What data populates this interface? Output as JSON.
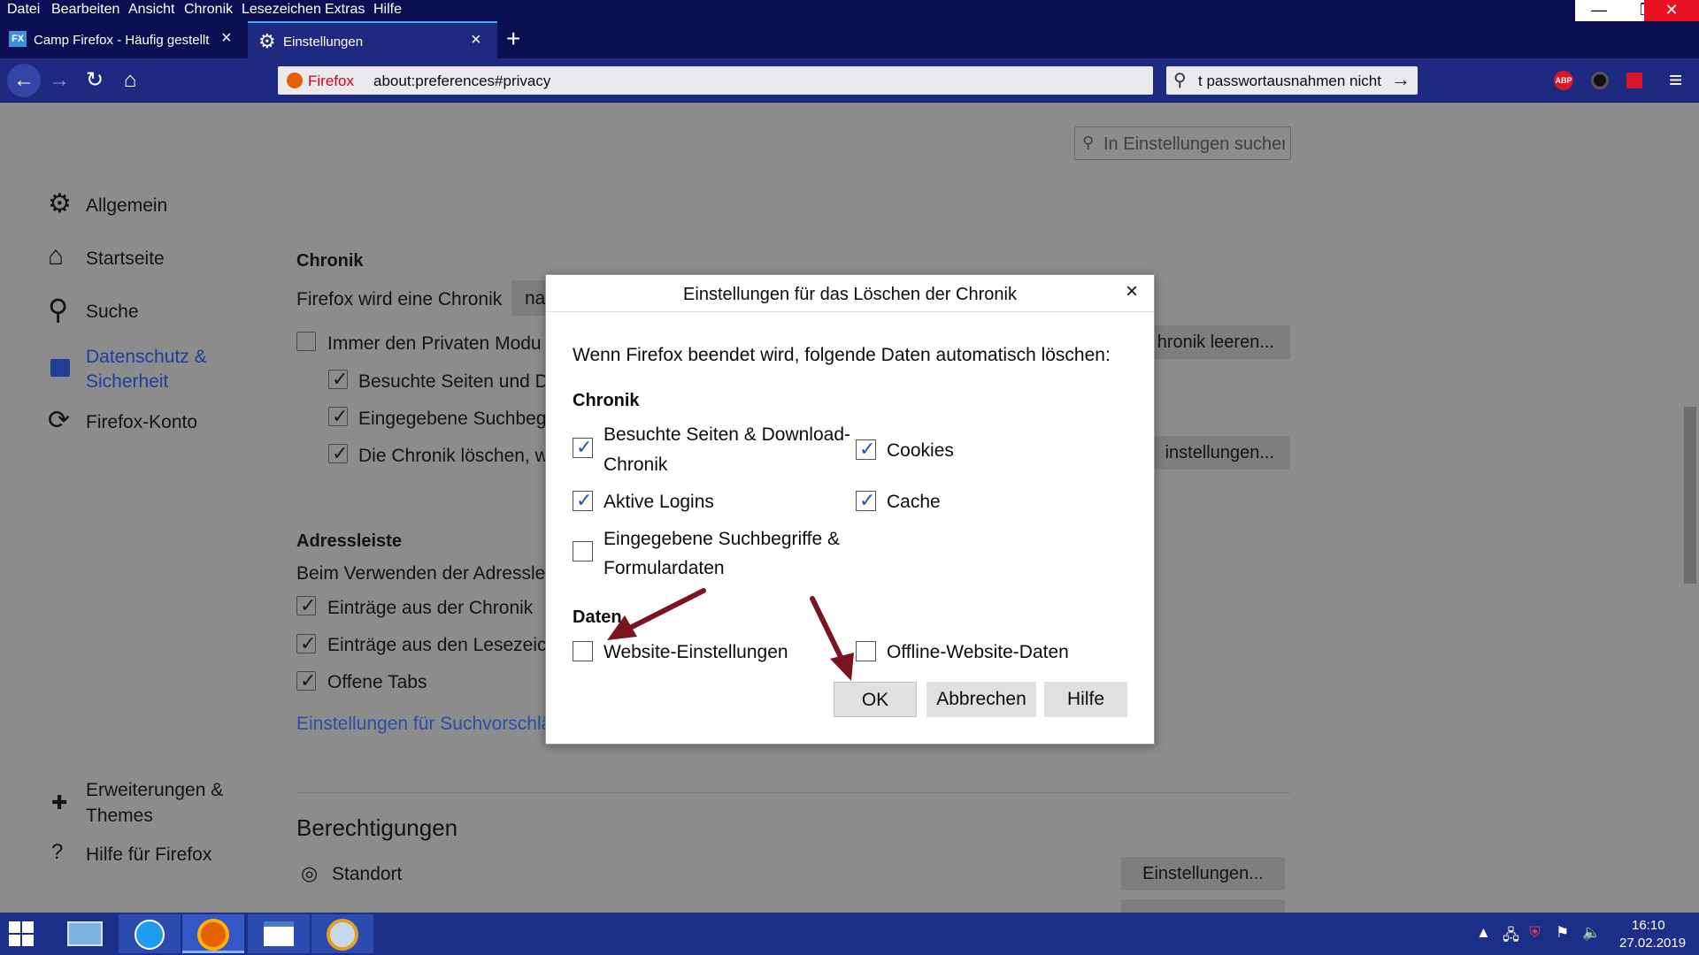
{
  "menu": {
    "items": [
      "Datei",
      "Bearbeiten",
      "Ansicht",
      "Chronik",
      "Lesezeichen",
      "Extras",
      "Hilfe"
    ],
    "window_controls": [
      "—",
      "❐",
      "✕"
    ]
  },
  "tabs": [
    {
      "label": "Camp Firefox - Häufig gestellt",
      "icon": "fx-site-icon"
    },
    {
      "label": "Einstellungen",
      "icon": "gear-icon"
    }
  ],
  "navbar": {
    "url_brand": "Firefox",
    "url": "about:preferences#privacy",
    "search_text": "t passwortausnahmen nicht"
  },
  "content": {
    "settings_search_placeholder": "In Einstellungen suchen",
    "sidebar": [
      {
        "label": "Allgemein",
        "icon": "gear-icon"
      },
      {
        "label": "Startseite",
        "icon": "home-icon"
      },
      {
        "label": "Suche",
        "icon": "search-icon"
      },
      {
        "label": "Datenschutz & Sicherheit",
        "icon": "lock-icon"
      },
      {
        "label": "Firefox-Konto",
        "icon": "sync-icon"
      }
    ],
    "sidebar_bottom": [
      {
        "label": "Erweiterungen & Themes",
        "icon": "puzzle-icon"
      },
      {
        "label": "Hilfe für Firefox",
        "icon": "help-icon"
      }
    ],
    "chronik": {
      "title": "Chronik",
      "line": "Firefox wird eine Chronik",
      "select_value": "na",
      "always_private": "Immer den Privaten Modu",
      "visited": "Besuchte Seiten und D",
      "searches": "Eingegebene Suchbeg",
      "clear_on_close": "Die Chronik löschen, w",
      "clear_button": "hronik leeren...",
      "settings_button": "instellungen..."
    },
    "adressleiste": {
      "title": "Adressleiste",
      "line": "Beim Verwenden der Adressle",
      "items": [
        "Einträge aus der Chronik",
        "Einträge aus den Lesezeich",
        "Offene Tabs"
      ],
      "link": "Einstellungen für Suchvorschlä"
    },
    "berechtigungen": {
      "title": "Berechtigungen",
      "standort": "Standort",
      "standort_button": "Einstellungen..."
    }
  },
  "dialog": {
    "title": "Einstellungen für das Löschen der Chronik",
    "intro": "Wenn Firefox beendet wird, folgende Daten automatisch löschen:",
    "chronik_title": "Chronik",
    "visited_l1": "Besuchte Seiten & Download-",
    "visited_l2": "Chronik",
    "visited_checked": true,
    "logins": "Aktive Logins",
    "logins_checked": true,
    "forms_l1": "Eingegebene Suchbegriffe &",
    "forms_l2": "Formulardaten",
    "forms_checked": false,
    "cookies": "Cookies",
    "cookies_checked": true,
    "cache": "Cache",
    "cache_checked": true,
    "daten_title": "Daten",
    "site_settings": "Website-Einstellungen",
    "site_settings_checked": false,
    "offline": "Offline-Website-Daten",
    "offline_checked": false,
    "ok": "OK",
    "cancel": "Abbrechen",
    "help": "Hilfe",
    "close": "×"
  },
  "taskbar": {
    "time": "16:10",
    "date": "27.02.2019"
  },
  "colors": {
    "titlebar": "#0c1053",
    "toolbar": "#1e2a80",
    "link": "#2b4ea6",
    "arrow": "#7a1420"
  }
}
